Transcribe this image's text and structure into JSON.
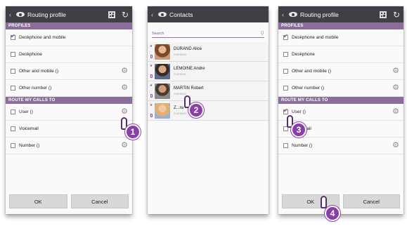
{
  "screen1": {
    "title": "Routing profile",
    "profiles_header": "PROFILES",
    "profiles": [
      {
        "label": "Deskphone and mobile",
        "checked": true,
        "gear": false
      },
      {
        "label": "Deskphone",
        "checked": false,
        "gear": false
      },
      {
        "label": "Other and mobile ()",
        "checked": false,
        "gear": true
      },
      {
        "label": "Other number ()",
        "checked": false,
        "gear": true
      }
    ],
    "route_header": "ROUTE MY CALLS TO",
    "routes": [
      {
        "label": "User ()",
        "checked": false,
        "gear": true
      },
      {
        "label": "Voicemail",
        "checked": false,
        "gear": false
      },
      {
        "label": "Number ()",
        "checked": false,
        "gear": true
      }
    ],
    "ok_label": "OK",
    "cancel_label": "Cancel",
    "step": "1"
  },
  "screen2": {
    "title": "Contacts",
    "search_placeholder": "Search",
    "contacts": [
      {
        "name": "DURAND Alice",
        "number": "21875040"
      },
      {
        "name": "LEMOINE Andre",
        "number": "21875041"
      },
      {
        "name": "MARTIN Robert",
        "number": "21875042"
      },
      {
        "name": "Z...ra",
        "number": "21875043"
      }
    ],
    "step": "2"
  },
  "screen3": {
    "title": "Routing profile",
    "profiles_header": "PROFILES",
    "profiles": [
      {
        "label": "Deskphone and mobile",
        "checked": true,
        "gear": false
      },
      {
        "label": "Deskphone",
        "checked": false,
        "gear": false
      },
      {
        "label": "Other and mobile ()",
        "checked": false,
        "gear": true
      },
      {
        "label": "Other number ()",
        "checked": false,
        "gear": true
      }
    ],
    "route_header": "ROUTE MY CALLS TO",
    "routes": [
      {
        "label": "User ()",
        "checked": true,
        "gear": true
      },
      {
        "label": "Voicemail",
        "checked": false,
        "gear": false
      },
      {
        "label": "Number ()",
        "checked": false,
        "gear": true
      }
    ],
    "ok_label": "OK",
    "cancel_label": "Cancel",
    "step3": "3",
    "step4": "4"
  },
  "icons": {
    "back": "chevron-left-icon",
    "brand": "eye-logo-icon",
    "qr": "qr-code-icon",
    "refresh": "refresh-icon",
    "gear": "gear-icon",
    "search": "search-icon",
    "star": "star-icon"
  },
  "colors": {
    "topbar": "#3f3f45",
    "section": "#8a6d9a",
    "accent": "#8a3fa8"
  }
}
